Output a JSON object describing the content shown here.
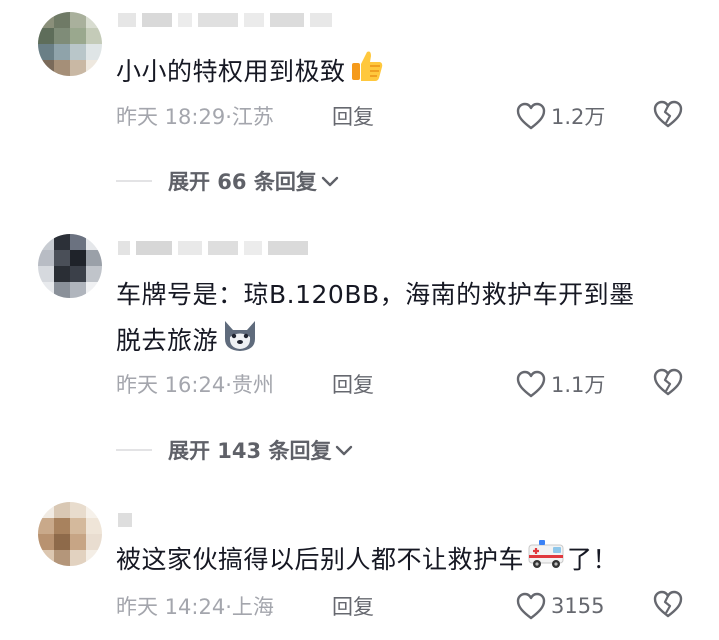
{
  "comments": [
    {
      "text": "小小的特权用到极致",
      "emoji_icon": "thumbs-up-emoji",
      "time": "昨天 18:29",
      "location": "江苏",
      "reply_label": "回复",
      "likes": "1.2万",
      "expand_label": "展开 66 条回复"
    },
    {
      "text_line1": "车牌号是：琼B.120BB，海南的救护车开到墨",
      "text_line2": "脱去旅游",
      "emoji_icon": "wolf-face-emoji",
      "time": "昨天 16:24",
      "location": "贵州",
      "reply_label": "回复",
      "likes": "1.1万",
      "expand_label": "展开 143 条回复"
    },
    {
      "text_before": "被这家伙搞得以后别人都不让救护车",
      "emoji_icon": "ambulance-emoji",
      "text_after": "了！",
      "time": "昨天 14:24",
      "location": "上海",
      "reply_label": "回复",
      "likes": "3155"
    }
  ],
  "separator": "·",
  "colors": {
    "text": "#161823",
    "meta": "#a4a6ad",
    "action": "#66686f"
  }
}
